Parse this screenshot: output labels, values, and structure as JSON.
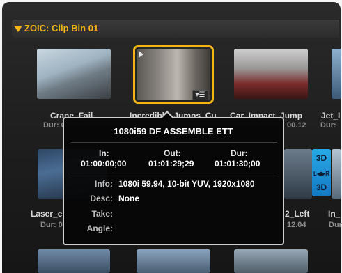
{
  "bin": {
    "title": "ZOIC: Clip Bin 01",
    "accent": "#f2b514"
  },
  "clips": [
    {
      "name": "Crane_Fail",
      "dur": "Dur: 0"
    },
    {
      "name": "Incredible_Jumps_Cu",
      "dur": ""
    },
    {
      "name": "Car_Impact_Jump",
      "dur": "00.12"
    },
    {
      "name": "Jet_I",
      "dur": "Dur:"
    },
    {
      "name": "Laser_e",
      "dur": "Dur: 0"
    },
    {
      "name": "2_Left",
      "dur": "12.04"
    },
    {
      "name": "In_",
      "dur": "Dur"
    }
  ],
  "stereo_badge": {
    "top": "3D",
    "mid": "L◀▶R",
    "bottom": "3D",
    "color": "#1e90d8"
  },
  "popover": {
    "title": "1080i59 DF ASSEMBLE ETT",
    "in_label": "In:",
    "out_label": "Out:",
    "dur_label": "Dur:",
    "in_tc": "01:00:00;00",
    "out_tc": "01:01:29;29",
    "dur_tc": "01:01:30;00",
    "info_label": "Info:",
    "info_value": "1080i 59.94, 10-bit YUV, 1920x1080",
    "desc_label": "Desc:",
    "desc_value": "None",
    "take_label": "Take:",
    "take_value": "",
    "angle_label": "Angle:",
    "angle_value": ""
  },
  "icons": {
    "play": "play-icon",
    "clip_menu": "list-menu-icon",
    "collapse": "triangle-down-icon"
  }
}
